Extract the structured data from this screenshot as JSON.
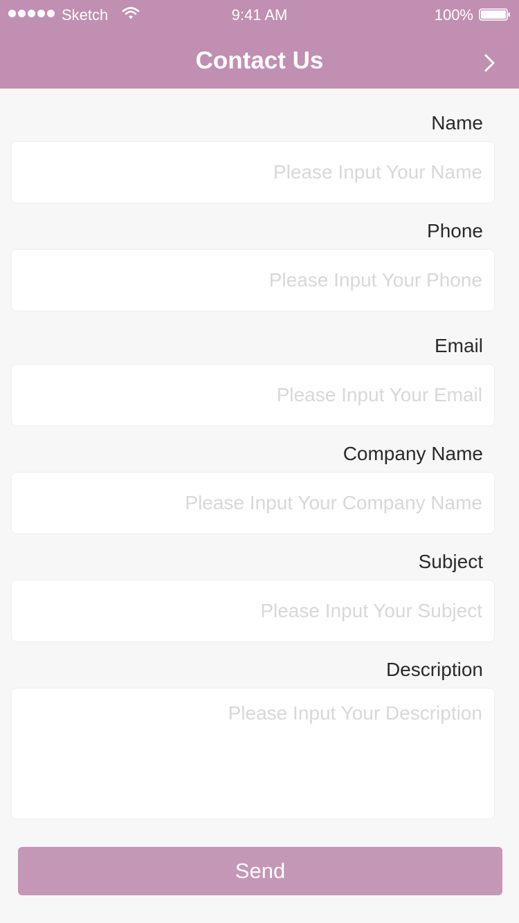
{
  "status_bar": {
    "carrier": "Sketch",
    "time": "9:41 AM",
    "battery": "100%"
  },
  "header": {
    "title": "Contact Us",
    "next_icon": "chevron-right-icon"
  },
  "form": {
    "fields": [
      {
        "label": "Name",
        "placeholder": "Please Input Your Name",
        "value": ""
      },
      {
        "label": "Phone",
        "placeholder": "Please Input Your Phone",
        "value": ""
      },
      {
        "label": "Email",
        "placeholder": "Please Input Your Email",
        "value": ""
      },
      {
        "label": "Company Name",
        "placeholder": "Please Input Your Company Name",
        "value": ""
      },
      {
        "label": "Subject",
        "placeholder": "Please Input Your Subject",
        "value": ""
      },
      {
        "label": "Description",
        "placeholder": "Please Input Your Description",
        "value": ""
      }
    ],
    "send_label": "Send"
  },
  "colors": {
    "header_bg": "#c08fb1",
    "button_bg": "#c597b6",
    "page_bg": "#f7f7f7",
    "placeholder": "#d8d8d8"
  }
}
